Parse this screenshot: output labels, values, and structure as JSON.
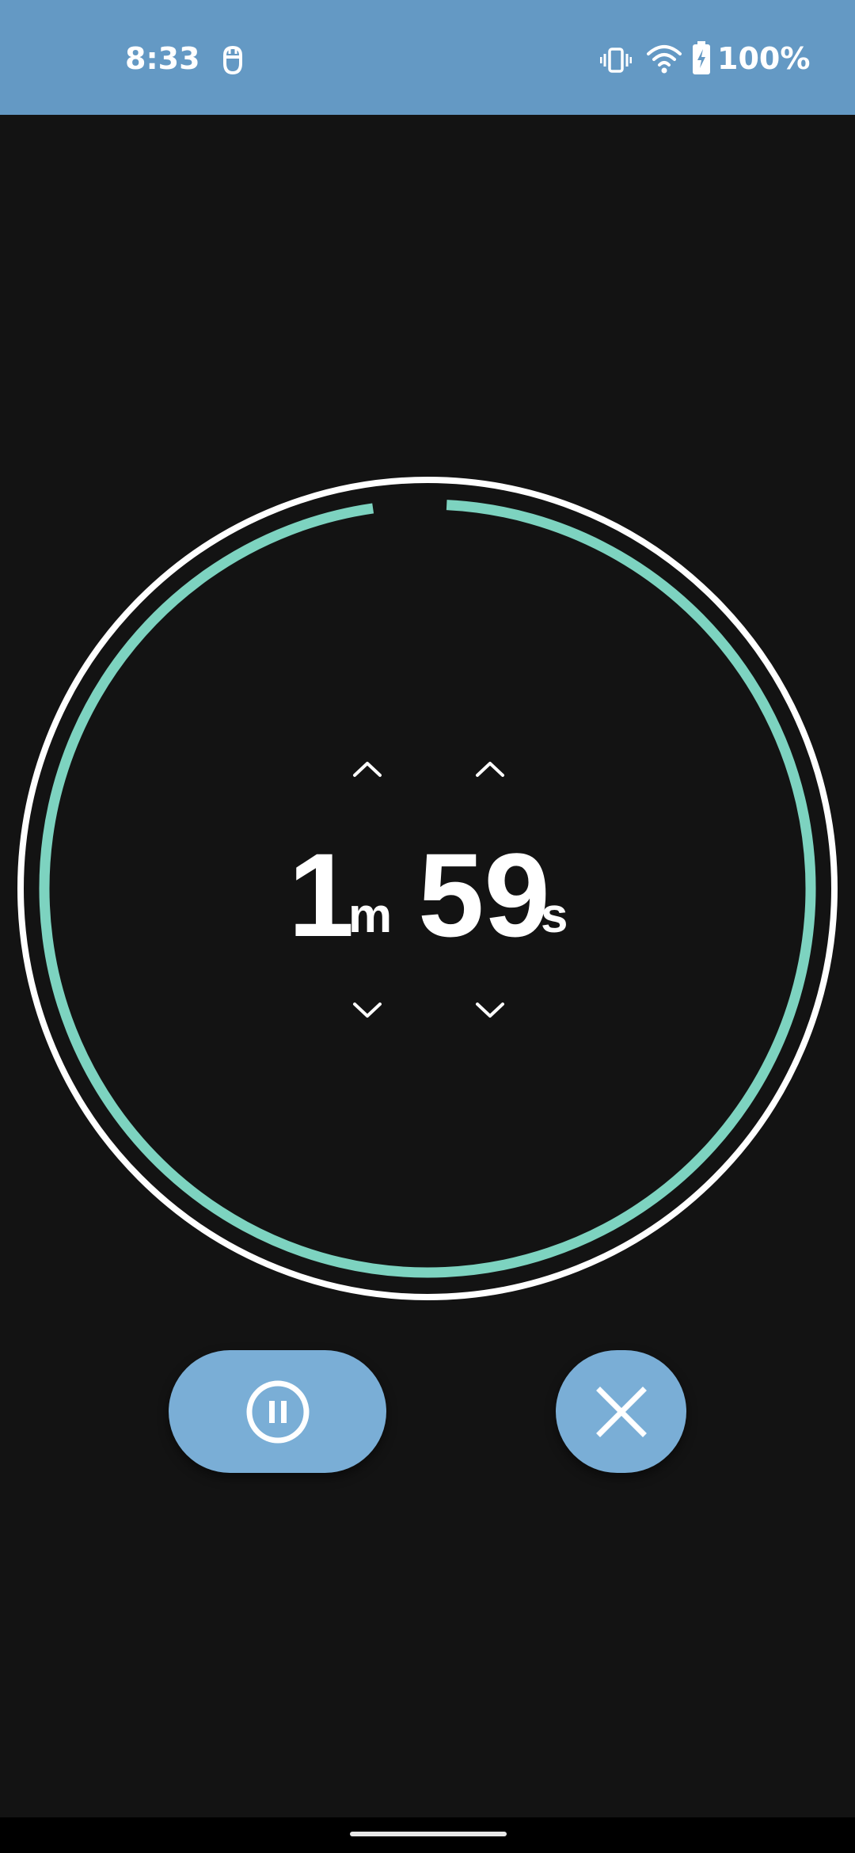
{
  "status_bar": {
    "time": "8:33",
    "battery_text": "100%",
    "icons": [
      "notification-app-icon",
      "vibrate-icon",
      "wifi-icon",
      "battery-charging-icon"
    ],
    "background_color": "#6499c4"
  },
  "timer": {
    "minutes": "1",
    "minutes_unit": "m",
    "seconds": "59",
    "seconds_unit": "s",
    "progress_fraction": 0.985,
    "progress_color": "#7dd3c0",
    "ring_color": "#ffffff"
  },
  "steppers": {
    "icons": [
      "chevron-up-icon",
      "chevron-down-icon"
    ]
  },
  "actions": {
    "pause_icon": "pause-icon",
    "close_icon": "close-icon",
    "button_color": "#7aaed6"
  }
}
